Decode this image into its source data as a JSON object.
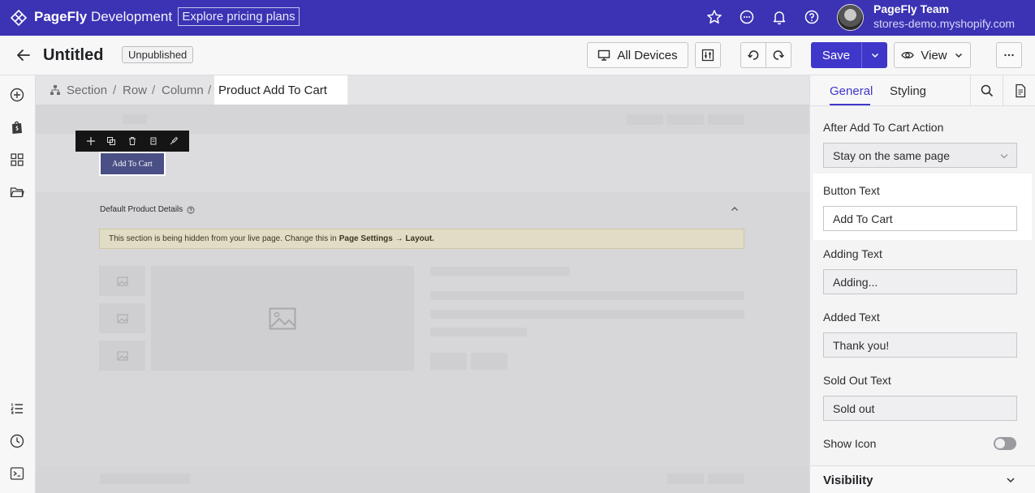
{
  "topbar": {
    "brand_bold": "PageFly",
    "brand_light": "Development",
    "pricing_label": "Explore pricing plans",
    "team_name": "PageFly Team",
    "team_store": "stores-demo.myshopify.com"
  },
  "subbar": {
    "page_title": "Untitled",
    "status": "Unpublished",
    "devices_label": "All Devices",
    "save_label": "Save",
    "view_label": "View"
  },
  "breadcrumb": {
    "items": [
      "Section",
      "Row",
      "Column"
    ],
    "active": "Product Add To Cart"
  },
  "canvas": {
    "add_to_cart_label": "Add To Cart",
    "details_title": "Default Product Details",
    "notice_text": "This section is being hidden from your live page. Change this in",
    "notice_link": "Page Settings → Layout."
  },
  "panel": {
    "tabs": [
      "General",
      "Styling"
    ],
    "after_action_label": "After Add To Cart Action",
    "after_action_value": "Stay on the same page",
    "button_text_label": "Button Text",
    "button_text_value": "Add To Cart",
    "adding_text_label": "Adding Text",
    "adding_text_value": "Adding...",
    "added_text_label": "Added Text",
    "added_text_value": "Thank you!",
    "sold_out_label": "Sold Out Text",
    "sold_out_value": "Sold out",
    "show_icon_label": "Show Icon",
    "visibility_label": "Visibility"
  },
  "colors": {
    "brand": "#3b33b4",
    "accent": "#3f37c9"
  }
}
